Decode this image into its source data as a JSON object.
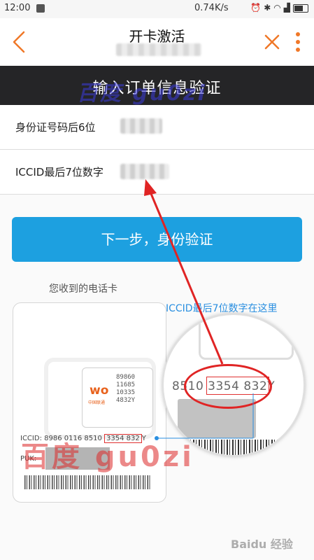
{
  "status_bar": {
    "time": "12:00",
    "network_speed": "0.74K/s",
    "icons": [
      "alarm-icon",
      "bluetooth-icon",
      "wifi-icon",
      "signal-icon",
      "battery-icon"
    ]
  },
  "header": {
    "title": "开卡激活",
    "back_icon": "chevron-left-icon",
    "close_icon": "close-icon",
    "more_icon": "more-vertical-icon",
    "accent_color": "#f07828"
  },
  "banner": {
    "text": "输入订单信息验证"
  },
  "form": {
    "id_label": "身份证号码后6位",
    "iccid_label": "ICCID最后7位数字"
  },
  "next_button": {
    "label": "下一步，身份验证",
    "color": "#1da0e0"
  },
  "illustration": {
    "caption": "您收到的电话卡",
    "hint": "ICCID最后7位数字在这里",
    "chip_logo": "wo",
    "chip_brand": "中国联通",
    "chip_code": "89860\n11685\n10335\n4832Y",
    "iccid_prefix": "ICCID:",
    "iccid_digits": "8986  0116  8510",
    "iccid_highlight": "3354 832",
    "iccid_suffix": "Y",
    "puk_label": "PUK:",
    "magnified_prefix": "8510",
    "magnified_highlight": "3354 832",
    "magnified_suffix": "Y"
  },
  "watermarks": {
    "top": "百度 gu0zi",
    "bottom": "百度  gu0zi",
    "baidu": "Baidu 经验"
  }
}
